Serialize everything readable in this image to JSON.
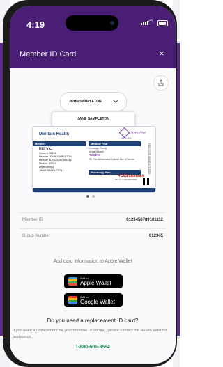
{
  "status_bar": {
    "time": "4:19"
  },
  "header": {
    "title": "Member ID Card",
    "close": "×"
  },
  "member_picker": {
    "selected": "JOHN SAMPLETON",
    "option": "JANE SAMPLETON"
  },
  "card": {
    "brand": "Meritain Health",
    "brand_sub": "an aetna company",
    "partner_logo": "MAPLEWAY HEALTH",
    "member_header": "Member",
    "employer": "Hill, Inc.",
    "group": "Group #:   09214",
    "member": "Member:   JOHN SAMPLETON",
    "member_id": "Member ID: 012345678910112",
    "division": "Division:   09204",
    "dependents_label": "Dependent(s):",
    "dependent": "JIMMY SAMPLETON",
    "medical_header": "Medical Plan",
    "coverage": "Coverage: Family",
    "network": "Aetna Network",
    "aetna": "♥aetna",
    "medical_note": "Rx Prior Authorization Claims Level of Service",
    "pharmacy_header": "Pharmacy Plan",
    "cvs": "♥CVS caremark",
    "rx_info": "Member: 000-000-0000",
    "side_text": "2023/12/31 DOB 01/01/1982"
  },
  "carousel": {
    "total": 2,
    "active": 1
  },
  "fields": [
    {
      "label": "Member ID",
      "value": "0123456789101112"
    },
    {
      "label": "Group Number",
      "value": "012345"
    }
  ],
  "wallet": {
    "prompt": "Add card information to Apple Wallet",
    "apple": {
      "small": "Add to",
      "big": "Apple Wallet"
    },
    "google": {
      "small": "Add to",
      "big": "Google Wallet"
    }
  },
  "replacement": {
    "question": "Do you need a replacement ID card?",
    "description": "If you need a replacement for your member ID card(s), please contact the Health Valet for assistance.",
    "phone": "1-800-606-3564"
  },
  "colors": {
    "purple": "#4b1e75",
    "navy": "#1d3f76",
    "green": "#1e8c5a"
  }
}
